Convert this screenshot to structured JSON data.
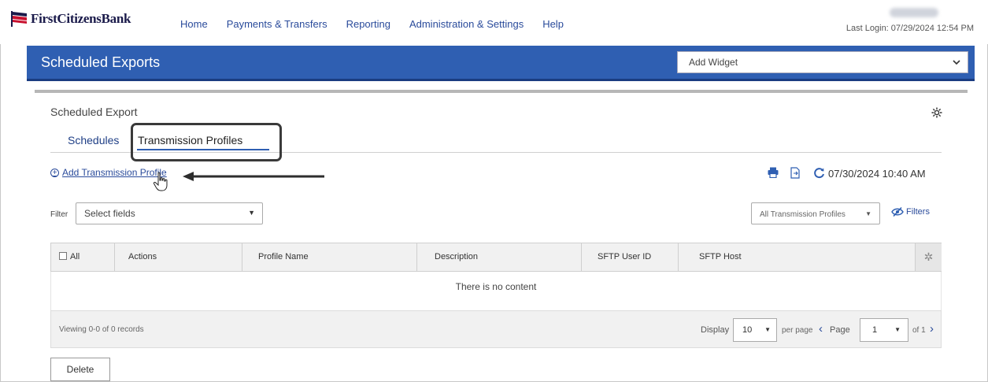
{
  "brand": {
    "name": "FirstCitizensBank",
    "accent": "#2f5fb2",
    "flag_red": "#c8102e",
    "flag_navy": "#1a1a4a"
  },
  "nav": {
    "items": [
      {
        "label": "Home"
      },
      {
        "label": "Payments & Transfers"
      },
      {
        "label": "Reporting"
      },
      {
        "label": "Administration & Settings"
      },
      {
        "label": "Help"
      }
    ],
    "last_login": "Last Login: 07/29/2024 12:54 PM"
  },
  "header": {
    "title": "Scheduled Exports",
    "widget_select": "Add Widget"
  },
  "panel": {
    "title": "Scheduled Export",
    "tabs": [
      {
        "label": "Schedules"
      },
      {
        "label": "Transmission Profiles",
        "active": true
      }
    ],
    "add_link": "Add Transmission Profile",
    "refreshed_at": "07/30/2024 10:40 AM",
    "filter": {
      "label": "Filter",
      "placeholder": "Select fields"
    },
    "profile_scope": "All Transmission Profiles",
    "filters_link": "Filters"
  },
  "table": {
    "columns": [
      {
        "label": "All"
      },
      {
        "label": "Actions"
      },
      {
        "label": "Profile Name"
      },
      {
        "label": "Description"
      },
      {
        "label": "SFTP User ID"
      },
      {
        "label": "SFTP Host"
      }
    ],
    "empty_message": "There is no content",
    "footer": {
      "viewing": "Viewing 0-0 of 0 records",
      "display_label": "Display",
      "page_size": "10",
      "per_page": "per page",
      "page_label": "Page",
      "page": "1",
      "of_pages": "of 1"
    }
  },
  "actions": {
    "delete_label": "Delete"
  }
}
